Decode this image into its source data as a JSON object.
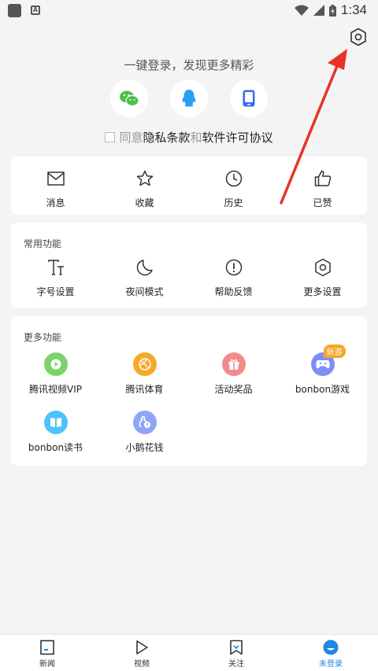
{
  "status_bar": {
    "time": "1:34"
  },
  "login": {
    "title": "一键登录，发现更多精彩",
    "agree_prefix": "同意",
    "privacy": "隐私条款",
    "and": "和",
    "license": "软件许可协议"
  },
  "quick": [
    {
      "label": "消息",
      "icon": "mail-icon"
    },
    {
      "label": "收藏",
      "icon": "star-icon"
    },
    {
      "label": "历史",
      "icon": "clock-icon"
    },
    {
      "label": "已赞",
      "icon": "thumbs-up-icon"
    }
  ],
  "common": {
    "title": "常用功能",
    "items": [
      {
        "label": "字号设置",
        "icon": "font-size-icon"
      },
      {
        "label": "夜间模式",
        "icon": "moon-icon"
      },
      {
        "label": "帮助反馈",
        "icon": "help-icon"
      },
      {
        "label": "更多设置",
        "icon": "settings-icon"
      }
    ]
  },
  "more": {
    "title": "更多功能",
    "items": [
      {
        "label": "腾讯视频VIP",
        "icon": "video-play-icon",
        "color": "#7bd36a"
      },
      {
        "label": "腾讯体育",
        "icon": "basketball-icon",
        "color": "#f7a928"
      },
      {
        "label": "活动奖品",
        "icon": "gift-icon",
        "color": "#f28b8b"
      },
      {
        "label": "bonbon游戏",
        "icon": "gamepad-icon",
        "color": "#7b8ff7",
        "badge": "新游"
      },
      {
        "label": "bonbon读书",
        "icon": "book-icon",
        "color": "#4fc3f7"
      },
      {
        "label": "小鹅花钱",
        "icon": "wallet-icon",
        "color": "#8ea6f7"
      }
    ]
  },
  "nav": [
    {
      "label": "新闻",
      "icon": "news-icon"
    },
    {
      "label": "视频",
      "icon": "play-icon"
    },
    {
      "label": "关注",
      "icon": "bookmark-icon"
    },
    {
      "label": "未登录",
      "icon": "avatar-icon",
      "active": true
    }
  ],
  "colors": {
    "accent": "#1e88e5",
    "annotation_arrow": "#e8332a"
  }
}
